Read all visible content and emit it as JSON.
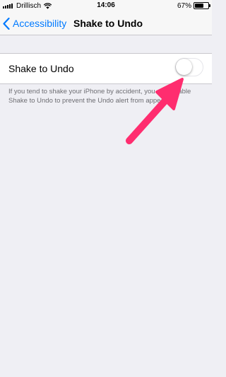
{
  "status_bar": {
    "carrier": "Drillisch",
    "time": "14:06",
    "battery_percent": "67%",
    "battery_level": 0.67,
    "icons": [
      "signal-icon",
      "wifi-icon",
      "battery-icon"
    ]
  },
  "nav": {
    "back_label": "Accessibility",
    "title": "Shake to Undo",
    "back_icon": "chevron-left-icon"
  },
  "setting": {
    "label": "Shake to Undo",
    "toggle_on": false
  },
  "footer": {
    "text": "If you tend to shake your iPhone by accident, you can disable Shake to Undo to prevent the Undo alert from appearing."
  },
  "colors": {
    "accent": "#007aff",
    "background": "#efeff4",
    "annotation_arrow": "#ff2d6f",
    "footer_text": "#6d6d72"
  }
}
